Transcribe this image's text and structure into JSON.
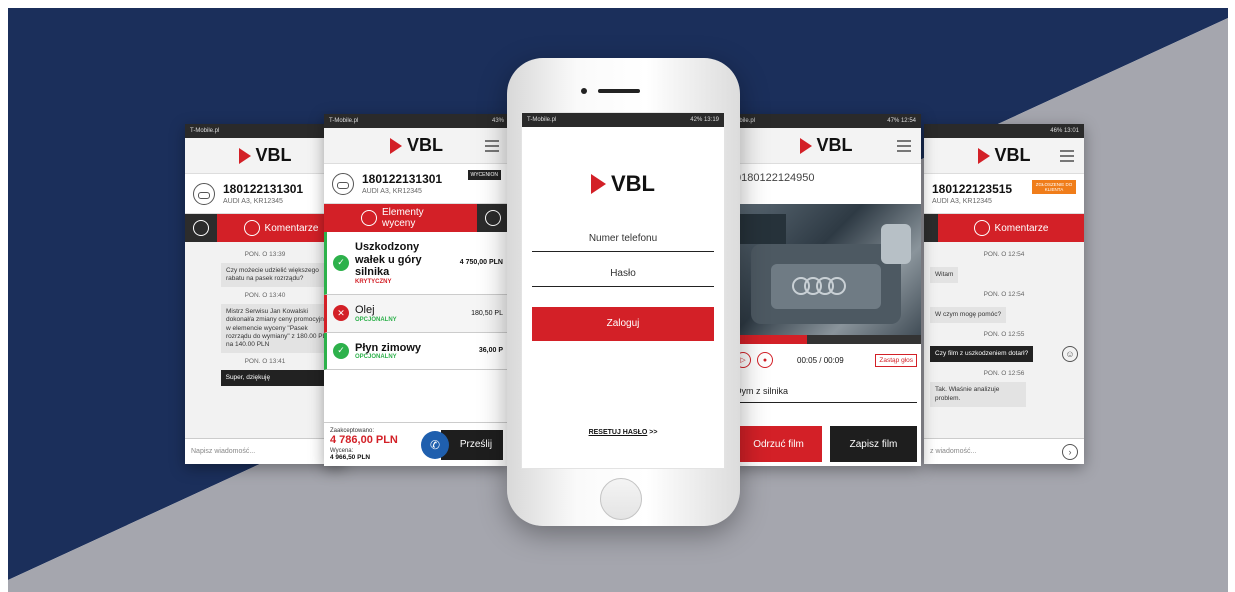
{
  "colors": {
    "navy": "#1b2f5b",
    "gray": "#a5a6ae",
    "brand_red": "#d32027",
    "green": "#2db14b"
  },
  "screen1": {
    "status_left": "T-Mobile.pl",
    "status_right": "",
    "logo_text": "VBL",
    "order_number": "180122131301",
    "car": "AUDI A3, KR12345",
    "tab_label": "Komentarze",
    "messages": [
      {
        "time": "PON. O 13:39",
        "text": "Czy możecie udzielić większego rabatu na pasek rozrządu?"
      },
      {
        "time": "PON. O 13:40",
        "text": "Mistrz Serwisu Jan Kowalski dokonał/a zmiany ceny promocyjnej w elemencie wyceny \"Pasek rozrządu do wymiany\" z 180.00 PLN na 140.00 PLN"
      },
      {
        "time": "PON. O 13:41",
        "text": "Super, dziękuję"
      }
    ],
    "input_placeholder": "Napisz wiadomość..."
  },
  "screen2": {
    "status_left": "T-Mobile.pl",
    "status_right": "43%",
    "logo_text": "VBL",
    "order_number": "180122131301",
    "badge": "WYCENION",
    "car": "AUDI A3, KR12345",
    "tab_label": "Elementy wyceny",
    "items": [
      {
        "name": "Uszkodzony wałek u góry silnika",
        "tag": "KRYTYCZNY",
        "price": "4 750,00 PLN"
      },
      {
        "name": "Olej",
        "tag": "OPCJONALNY",
        "price": "180,50 PL"
      },
      {
        "name": "Płyn zimowy",
        "tag": "OPCJONALNY",
        "price": "36,00 P"
      }
    ],
    "accepted_label": "Zaakceptowano:",
    "accepted_value": "4 786,00 PLN",
    "valuation_label": "Wycena:",
    "valuation_value": "4 966,50 PLN",
    "send_label": "Prześlij"
  },
  "phone": {
    "status_left": "T-Mobile.pl",
    "status_right": "42% 13:19",
    "logo_text": "VBL",
    "phone_placeholder": "Numer telefonu",
    "password_placeholder": "Hasło",
    "login_label": "Zaloguj",
    "reset_label": "RESETUJ HASŁO",
    "reset_arrows": ">>"
  },
  "screen4": {
    "status_left": "obile.pl",
    "status_right": "47% 12:54",
    "logo_text": "VBL",
    "order_number": "0180122124950",
    "video_progress": 0.4,
    "time": "00:05 / 00:09",
    "replace_voice": "Zastąp głos",
    "video_title": "Dym z silnika",
    "discard_label": "Odrzuć film",
    "save_label": "Zapisz film"
  },
  "screen5": {
    "status_left": "",
    "status_right": "46% 13:01",
    "logo_text": "VBL",
    "order_number": "180122123515",
    "badge": "ZGŁOSZENIE DO KLIENTA",
    "car": "AUDI A3, KR12345",
    "tab_label": "Komentarze",
    "messages": [
      {
        "time": "PON. O 12:54",
        "text": "Witam"
      },
      {
        "time": "PON. O 12:54",
        "text": "W czym mogę pomóc?"
      },
      {
        "time": "PON. O 12:55",
        "text": "Czy film z uszkodzeniem dotarł?"
      },
      {
        "time": "PON. O 12:56",
        "text": "Tak. Właśnie analizuje problem."
      }
    ],
    "input_placeholder": "z wiadomość..."
  }
}
